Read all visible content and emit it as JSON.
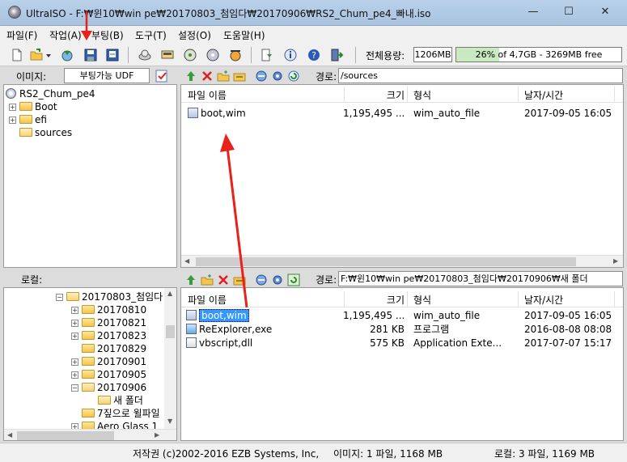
{
  "window": {
    "title": "UltraISO - F:₩윈10₩win pe₩20170803_첨임다₩20170906₩RS2_Chum_pe4_빠내.iso",
    "minimize": "—",
    "maximize": "☐",
    "close": "✕"
  },
  "menu": [
    "파일(F)",
    "작업(A)",
    "부팅(B)",
    "도구(T)",
    "설정(O)",
    "도움말(H)"
  ],
  "toolbar": {
    "icons": [
      "new-icon",
      "open-icon",
      "dropdown-icon",
      "extract-icon",
      "save-icon",
      "save-as-icon",
      "mount-icon",
      "virtual-drive-icon",
      "burn-icon",
      "compress-icon",
      "convert-icon",
      "properties-icon",
      "info-icon",
      "help-icon",
      "exit-icon"
    ],
    "total_size_label": "전체용량:",
    "total_size_value": "1206MB",
    "usage_text": "26% of 4,7GB - 3269MB free",
    "usage_fraction": 0.26
  },
  "image": {
    "label": "이미지:",
    "type_value": "부팅가능 UDF",
    "path_label": "경로:",
    "path_value": "/sources",
    "tree": [
      {
        "label": "RS2_Chum_pe4",
        "kind": "disc"
      },
      {
        "label": "Boot",
        "kind": "folder"
      },
      {
        "label": "efi",
        "kind": "folder"
      },
      {
        "label": "sources",
        "kind": "folder-open"
      }
    ],
    "columns": [
      "파일 이름",
      "크기",
      "형식",
      "날자/시간"
    ],
    "files": [
      {
        "name": "boot,wim",
        "size": "1,195,495 ...",
        "type": "wim_auto_file",
        "date": "2017-09-05 16:05"
      }
    ]
  },
  "local": {
    "label": "로컬:",
    "path_label": "경로:",
    "path_value": "F:₩윈10₩win pe₩20170803_첨임다₩20170906₩새 폴더",
    "tree": [
      {
        "label": "20170803_첨임다",
        "level": 0
      },
      {
        "label": "20170810",
        "level": 1
      },
      {
        "label": "20170821",
        "level": 1
      },
      {
        "label": "20170823",
        "level": 1
      },
      {
        "label": "20170829",
        "level": 1
      },
      {
        "label": "20170901",
        "level": 1
      },
      {
        "label": "20170905",
        "level": 1
      },
      {
        "label": "20170906",
        "level": 1
      },
      {
        "label": "새 폴더",
        "level": 2
      },
      {
        "label": "7짚으로 윌파일",
        "level": 1
      },
      {
        "label": "Aero Glass 1",
        "level": 1
      }
    ],
    "columns": [
      "파일 이름",
      "크기",
      "형식",
      "날자/시간"
    ],
    "files": [
      {
        "name": "boot,wim",
        "size": "1,195,495 ...",
        "type": "wim_auto_file",
        "date": "2017-09-05 16:05"
      },
      {
        "name": "ReExplorer,exe",
        "size": "281 KB",
        "type": "프로그램",
        "date": "2016-08-08 08:08"
      },
      {
        "name": "vbscript,dll",
        "size": "575 KB",
        "type": "Application Exte...",
        "date": "2017-07-07 15:17"
      }
    ]
  },
  "status": {
    "copyright": "저작권 (c)2002-2016 EZB Systems, Inc,",
    "image": "이미지: 1 파일, 1168 MB",
    "local": "로컬: 3 파일, 1169 MB"
  },
  "annotation_color": "#e8211b"
}
